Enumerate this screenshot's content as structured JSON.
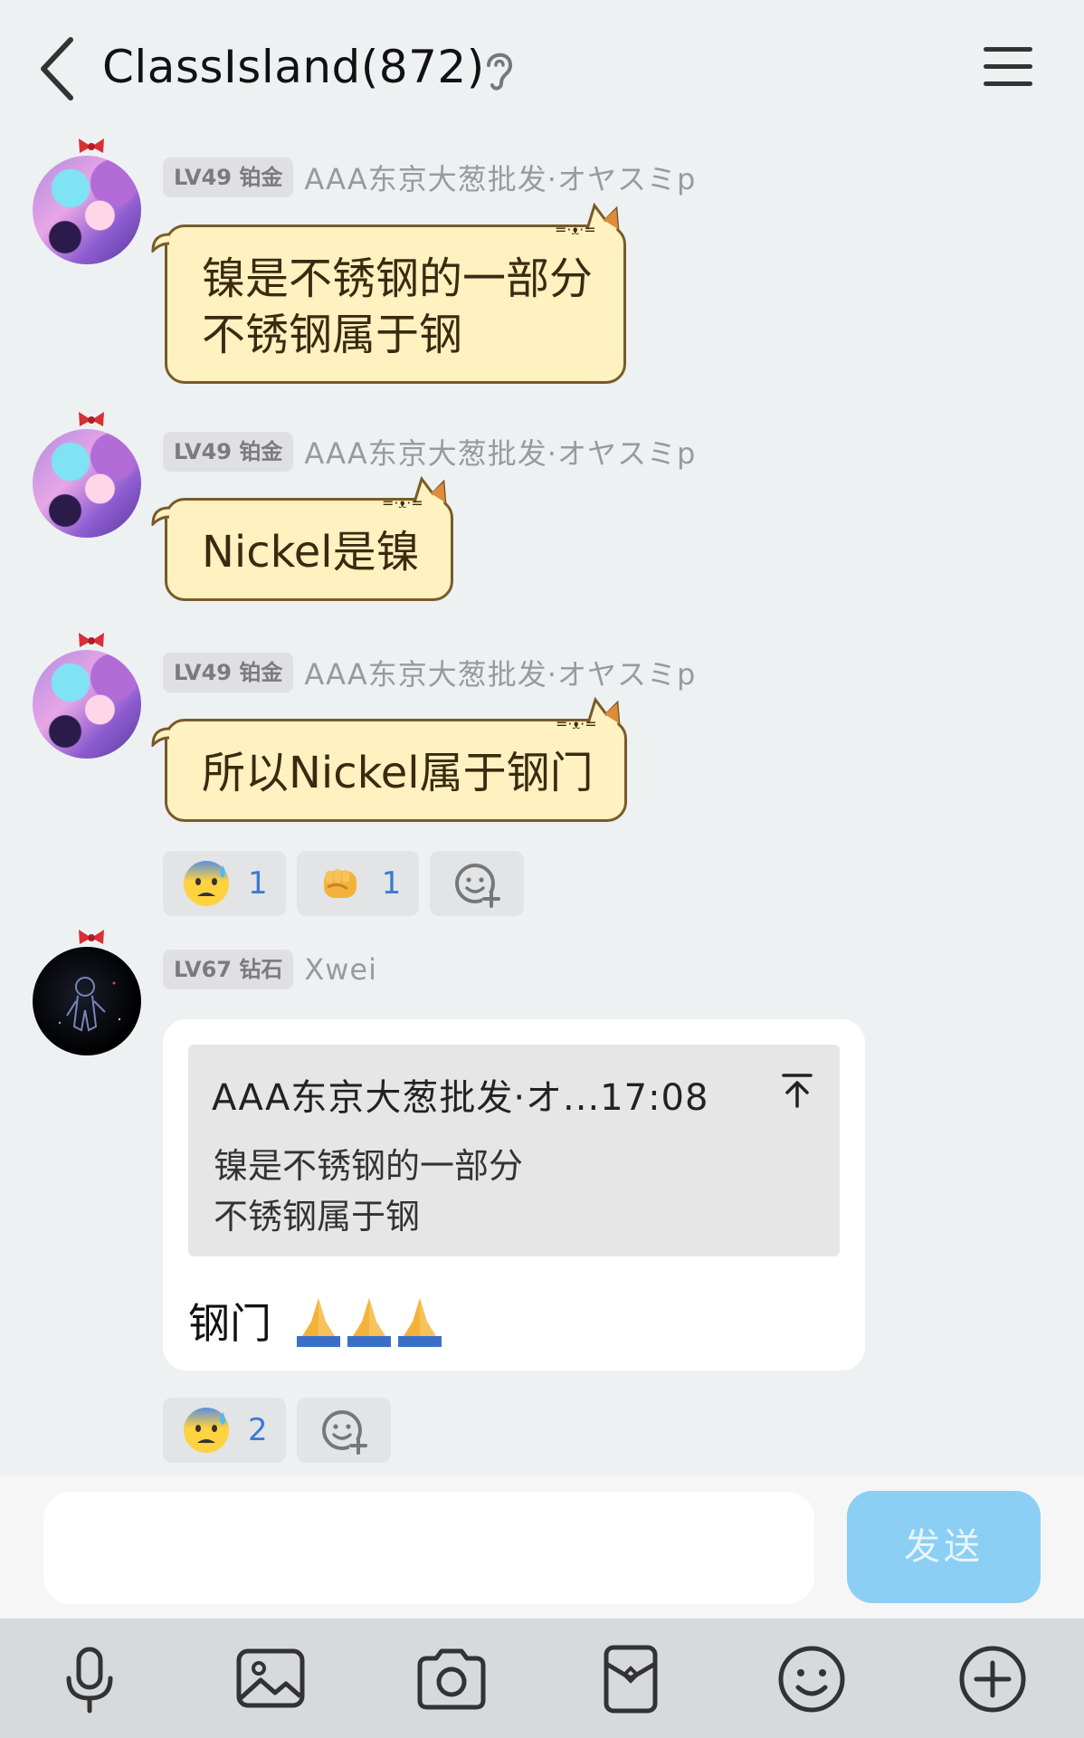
{
  "header": {
    "title": "ClassIsland(872)"
  },
  "messages": [
    {
      "level": "LV49 铂金",
      "sender": "AAA东京大葱批发·オヤスミp",
      "lines": [
        "镍是不锈钢的一部分",
        "不锈钢属于钢"
      ]
    },
    {
      "level": "LV49 铂金",
      "sender": "AAA东京大葱批发·オヤスミp",
      "lines": [
        "Nickel是镍"
      ]
    },
    {
      "level": "LV49 铂金",
      "sender": "AAA东京大葱批发·オヤスミp",
      "lines": [
        "所以Nickel属于钢门"
      ],
      "reactions": [
        {
          "emoji": "anxious-sweat-face-icon",
          "count": "1"
        },
        {
          "emoji": "fist-icon",
          "count": "1"
        }
      ]
    },
    {
      "level": "LV67 钻石",
      "sender": "Xwei",
      "quote": {
        "header": "AAA东京大葱批发·オ...17:08",
        "lines": [
          "镍是不锈钢的一部分",
          "不锈钢属于钢"
        ]
      },
      "text": "钢门",
      "reactions": [
        {
          "emoji": "anxious-sweat-face-icon",
          "count": "2"
        }
      ]
    }
  ],
  "composer": {
    "input_value": "",
    "send_label": "发送"
  },
  "toolbar": {
    "icons": [
      "microphone-icon",
      "image-icon",
      "camera-icon",
      "red-packet-icon",
      "emoji-icon",
      "plus-icon"
    ]
  },
  "colors": {
    "background": "#eef1f2",
    "cat_bubble_fill": "#fff1c0",
    "cat_bubble_border": "#7a5a2a",
    "reaction_count": "#3d7ad6",
    "send_button": "#8ccff5",
    "toolbar": "#d7dadd"
  }
}
